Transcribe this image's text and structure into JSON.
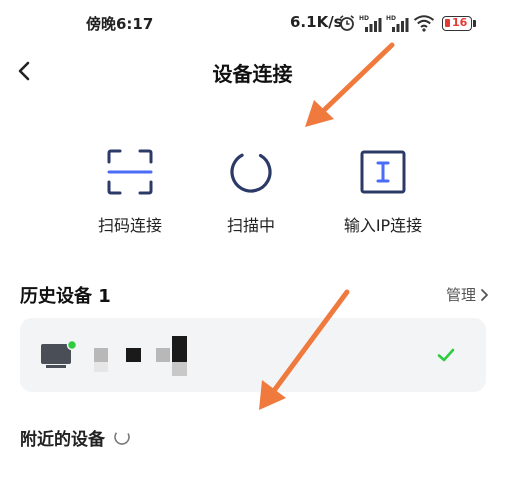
{
  "status_bar": {
    "time": "傍晚6:17",
    "speed": "6.1K/s",
    "battery": "16",
    "icons": [
      "alarm-icon",
      "hd-signal-icon",
      "hd-signal-icon",
      "wifi-icon",
      "battery-icon"
    ]
  },
  "nav": {
    "title": "设备连接",
    "back_icon": "chevron-left-icon"
  },
  "methods": [
    {
      "label": "扫码连接",
      "icon": "scan-icon"
    },
    {
      "label": "扫描中",
      "icon": "loading-spinner-icon"
    },
    {
      "label": "输入IP连接",
      "icon": "text-input-icon"
    }
  ],
  "history": {
    "title": "历史设备 1",
    "manage_label": "管理",
    "devices": [
      {
        "icon": "tv-icon",
        "name": "",
        "connected_icon": "check-icon",
        "online_color": "#2ecc40"
      }
    ]
  },
  "nearby": {
    "title": "附近的设备",
    "icon": "loading-spinner-icon"
  },
  "colors": {
    "accent": "#2b3a67",
    "check": "#2ecc40",
    "annotation_arrow": "#f07a3d"
  }
}
